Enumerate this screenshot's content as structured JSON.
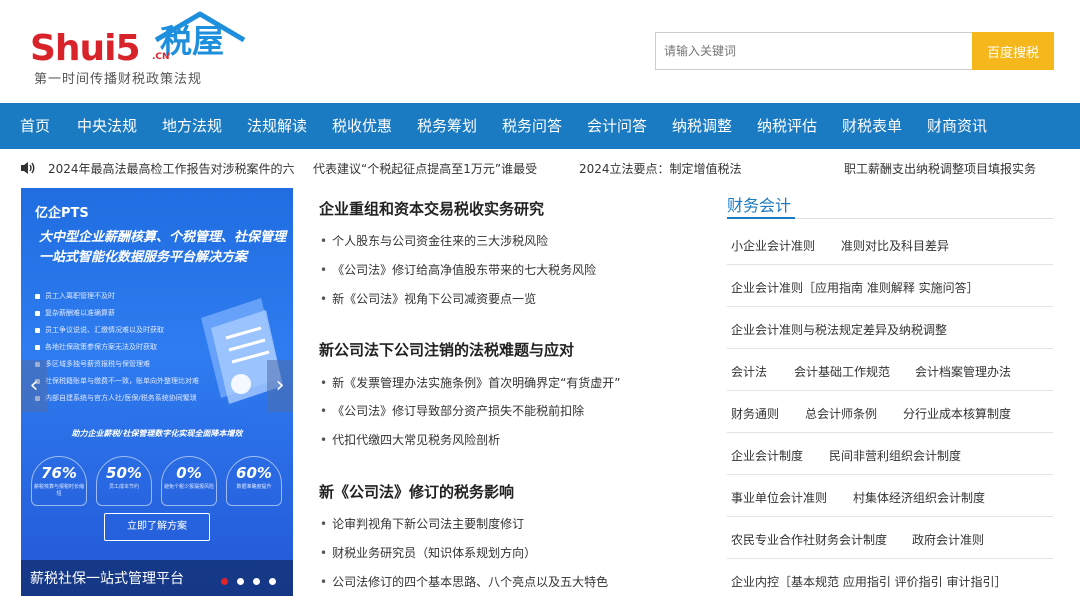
{
  "header": {
    "logo_main": "Shui5",
    "logo_house": "税屋",
    "logo_cn": ".CN",
    "slogan": "第一时间传播财税政策法规",
    "search_placeholder": "请输入关键词",
    "search_button": "百度搜税"
  },
  "nav": [
    "首页",
    "中央法规",
    "地方法规",
    "法规解读",
    "税收优惠",
    "税务筹划",
    "税务问答",
    "会计问答",
    "纳税调整",
    "纳税评估",
    "财税表单",
    "财商资讯"
  ],
  "ticker": [
    "2024年最高法最高检工作报告对涉税案件的六",
    "代表建议“个税起征点提高至1万元”谁最受",
    "2024立法要点：制定增值税法",
    "职工薪酬支出纳税调整项目填报实务"
  ],
  "banner": {
    "logo": "亿企PTS",
    "title": "大中型企业薪酬核算、个税管理、社保管理一站式智能化数据服务平台解决方案",
    "features": [
      "员工入离职管理不及时",
      "复杂薪酬难以准确算薪",
      "员工争议说说、汇缴情况难以及时获取",
      "各地社保政策参保方案无法及时获取",
      "多区域多独号薪资报税与保管理难",
      "社保税籍账单与缴费不一致，账单向外整理比对难",
      "内部自建系统与官方人社/医保/税务系统协同繁琐"
    ],
    "subtitle": "助力企业薪税/社保管理数字化实现全面降本增效",
    "stats": [
      {
        "value": "76%",
        "label": "薪税核算与报税时长缩短"
      },
      {
        "value": "50%",
        "label": "员工成本节约"
      },
      {
        "value": "0%",
        "label": "避免个税少报漏报风险"
      },
      {
        "value": "60%",
        "label": "数据准确度提升"
      }
    ],
    "cta": "立即了解方案",
    "caption": "薪税社保一站式管理平台",
    "prev": "‹",
    "next": "›"
  },
  "sections": [
    {
      "title": "企业重组和资本交易税收实务研究",
      "items": [
        "个人股东与公司资金往来的三大涉税风险",
        "《公司法》修订给高净值股东带来的七大税务风险",
        "新《公司法》视角下公司减资要点一览"
      ]
    },
    {
      "title": "新公司法下公司注销的法税难题与应对",
      "items": [
        "新《发票管理办法实施条例》首次明确界定“有货虚开”",
        "《公司法》修订导致部分资产损失不能税前扣除",
        "代扣代缴四大常见税务风险剖析"
      ]
    },
    {
      "title": "新《公司法》修订的税务影响",
      "items": [
        "论审判视角下新公司法主要制度修订",
        "财税业务研究员（知识体系规划方向）",
        "公司法修订的四个基本思路、八个亮点以及五大特色"
      ]
    }
  ],
  "right": {
    "heading": "财务会计",
    "rows": [
      [
        "小企业会计准则",
        "准则对比及科目差异"
      ],
      [
        "企业会计准则［应用指南  准则解释  实施问答］"
      ],
      [
        "企业会计准则与税法规定差异及纳税调整"
      ],
      [
        "会计法",
        "会计基础工作规范",
        "会计档案管理办法"
      ],
      [
        "财务通则",
        "总会计师条例",
        "分行业成本核算制度"
      ],
      [
        "企业会计制度",
        "民间非营利组织会计制度"
      ],
      [
        "事业单位会计准则",
        "村集体经济组织会计制度"
      ],
      [
        "农民专业合作社财务会计制度",
        "政府会计准则"
      ],
      [
        "企业内控［基本规范  应用指引  评价指引  审计指引］"
      ]
    ]
  },
  "colors": {
    "nav_bg": "#1a7ac2",
    "search_btn": "#f6b71c",
    "logo_red": "#d9232a",
    "logo_blue": "#1d8fdc"
  }
}
